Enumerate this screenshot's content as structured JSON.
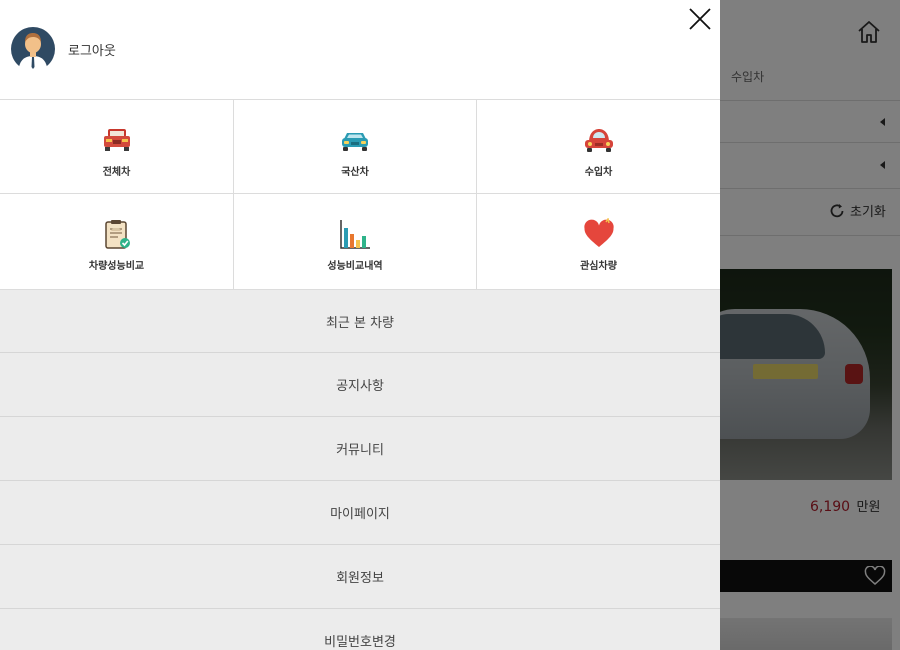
{
  "background": {
    "tab_import": "수입차",
    "reset_label": "초기화",
    "price_value": "6,190",
    "price_unit": "만원"
  },
  "drawer": {
    "logout_label": "로그아웃",
    "quick_menu": [
      {
        "label": "전체차",
        "icon": "car-truck-icon"
      },
      {
        "label": "국산차",
        "icon": "domestic-car-icon"
      },
      {
        "label": "수입차",
        "icon": "import-car-icon"
      },
      {
        "label": "차량성능비교",
        "icon": "clipboard-check-icon"
      },
      {
        "label": "성능비교내역",
        "icon": "bar-chart-icon"
      },
      {
        "label": "관심차량",
        "icon": "heart-icon"
      }
    ],
    "menu_items": [
      "최근 본 차량",
      "공지사항",
      "커뮤니티",
      "마이페이지",
      "회원정보",
      "비밀번호변경"
    ]
  },
  "colors": {
    "overlay": "#000000",
    "drawer_bg": "#ececec",
    "price_red": "#b21d2b",
    "car_red": "#d24a3c",
    "car_teal": "#2a9bb3",
    "heart_red": "#e5463c"
  }
}
